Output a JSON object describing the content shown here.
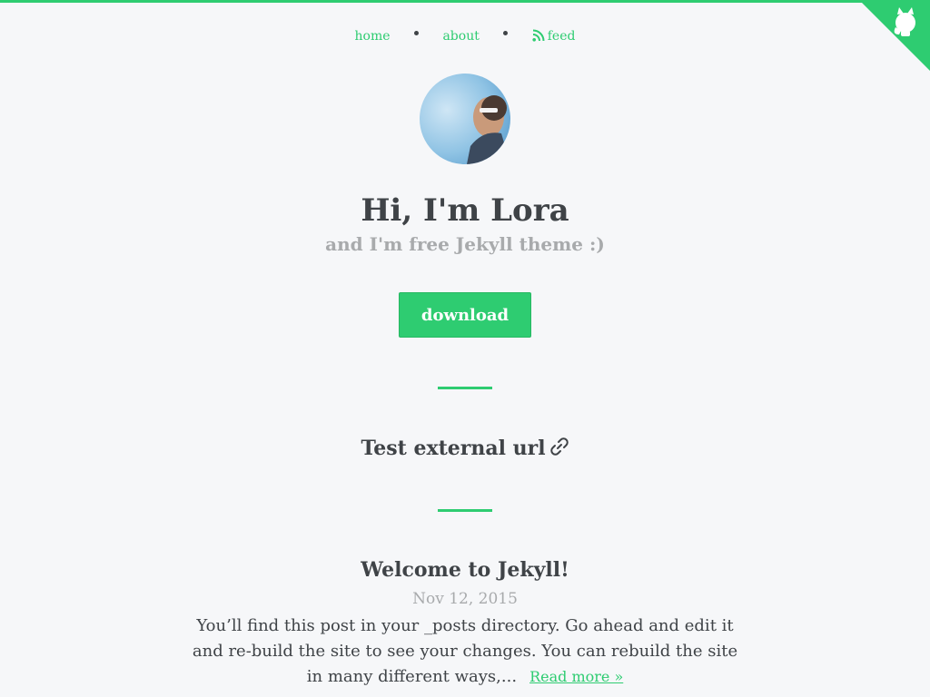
{
  "colors": {
    "accent": "#2ecc71",
    "text": "#3f4347",
    "muted": "#a8aaac",
    "background": "#f6f7f9"
  },
  "nav": {
    "items": [
      {
        "label": "home"
      },
      {
        "label": "about"
      },
      {
        "label": "feed",
        "icon": "rss-icon"
      }
    ]
  },
  "corner": {
    "icon": "github-octocat-icon"
  },
  "hero": {
    "avatar_alt": "avatar",
    "title": "Hi, I'm Lora",
    "subtitle": "and I'm free Jekyll theme :)",
    "button_label": "download"
  },
  "posts": [
    {
      "title": "Test external url",
      "icon": "link-icon"
    },
    {
      "title": "Welcome to Jekyll!",
      "date": "Nov 12, 2015",
      "excerpt": "You’ll find this post in your _posts directory. Go ahead and edit it and re-build the site to see your changes. You can rebuild the site in many different ways,...",
      "read_more": "Read more »"
    }
  ]
}
